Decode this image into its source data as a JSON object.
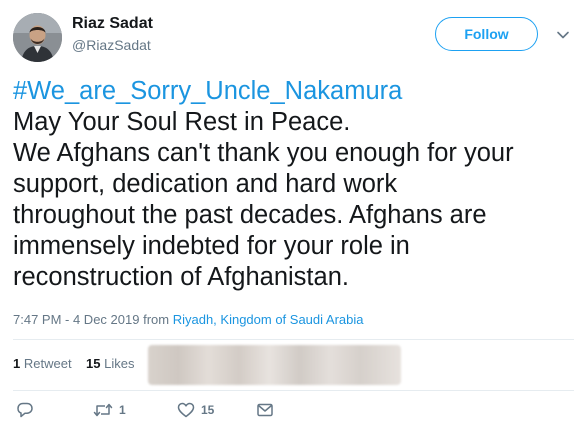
{
  "user": {
    "display_name": "Riaz Sadat",
    "handle": "@RiazSadat"
  },
  "follow_button": {
    "label": "Follow"
  },
  "tweet": {
    "hashtag": "#We_are_Sorry_Uncle_Nakamura",
    "lines": [
      "May Your Soul Rest in Peace.",
      "We Afghans can't thank you enough for your",
      "support, dedication and hard work",
      "throughout the past decades. Afghans are",
      "immensely indebted for your role in",
      "reconstruction of Afghanistan."
    ]
  },
  "meta": {
    "timestamp": "7:47 PM - 4 Dec 2019",
    "from_label": "from",
    "location": "Riyadh, Kingdom of Saudi Arabia"
  },
  "stats": {
    "retweets_count": "1",
    "retweets_label": "Retweet",
    "likes_count": "15",
    "likes_label": "Likes"
  },
  "actions": {
    "reply_icon": "reply-icon",
    "retweet_icon": "retweet-icon",
    "retweet_count": "1",
    "like_icon": "heart-icon",
    "like_count": "15",
    "message_icon": "envelope-icon"
  },
  "colors": {
    "accent": "#1da1f2",
    "link": "#1b95e0",
    "text": "#14171a",
    "secondary": "#657786",
    "divider": "#e6ecf0"
  }
}
